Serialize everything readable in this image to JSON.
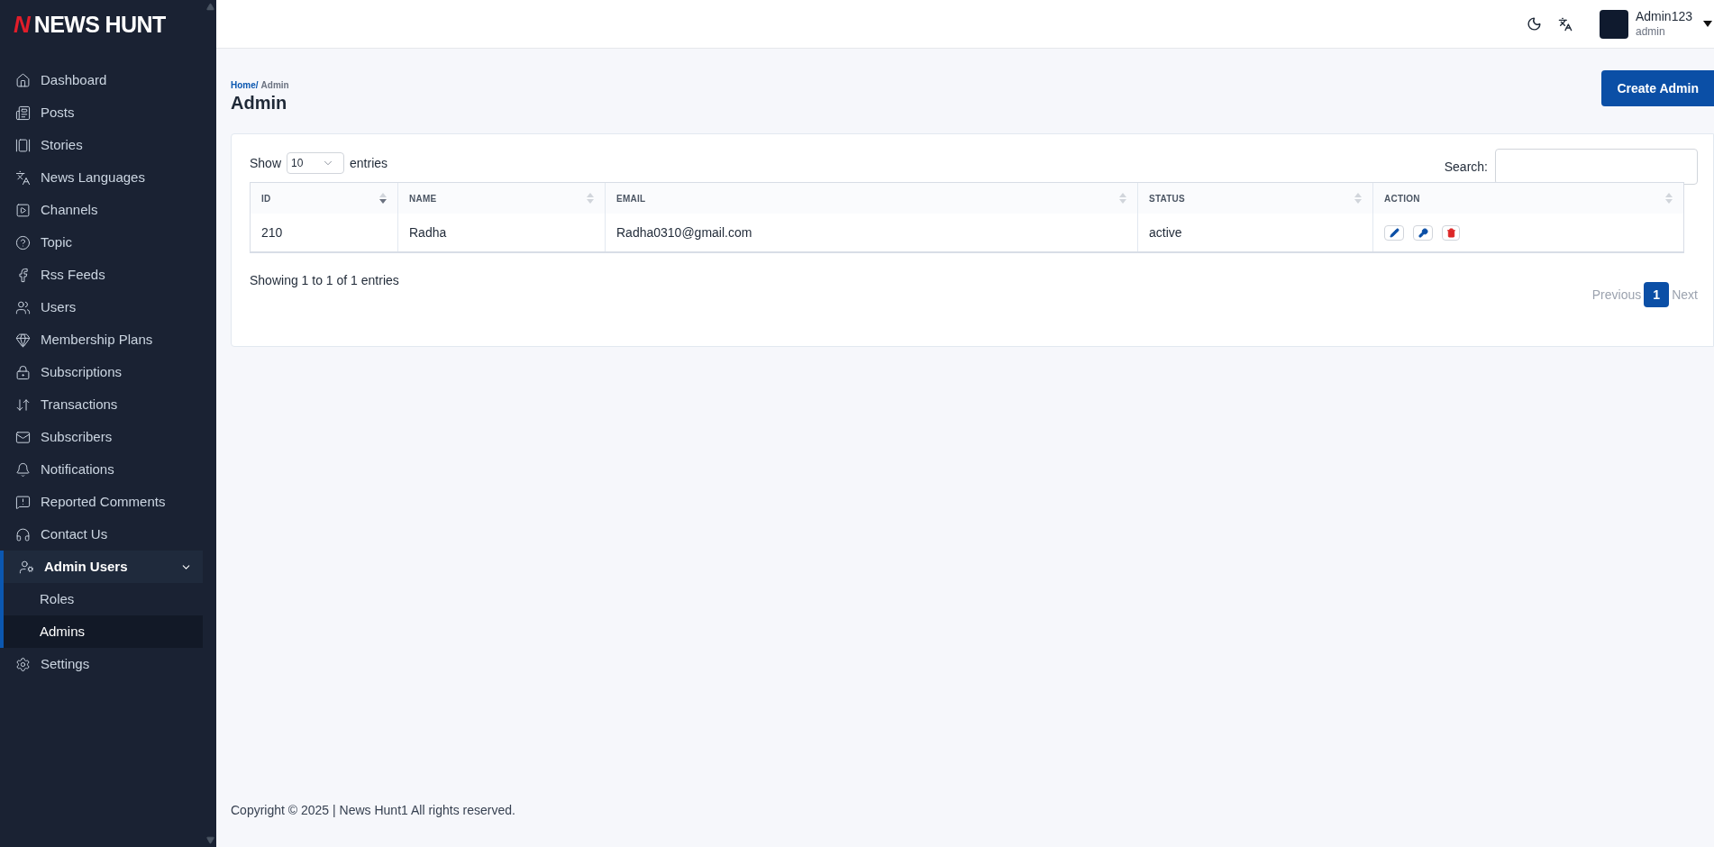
{
  "brand": {
    "mark": "N",
    "name": "NEWS HUNT"
  },
  "sidebar": {
    "items": [
      {
        "label": "Dashboard",
        "selected": false
      },
      {
        "label": "Posts",
        "selected": false
      },
      {
        "label": "Stories",
        "selected": false
      },
      {
        "label": "News Languages",
        "selected": false
      },
      {
        "label": "Channels",
        "selected": false
      },
      {
        "label": "Topic",
        "selected": false
      },
      {
        "label": "Rss Feeds",
        "selected": false
      },
      {
        "label": "Users",
        "selected": false
      },
      {
        "label": "Membership Plans",
        "selected": false
      },
      {
        "label": "Subscriptions",
        "selected": false
      },
      {
        "label": "Transactions",
        "selected": false
      },
      {
        "label": "Subscribers",
        "selected": false
      },
      {
        "label": "Notifications",
        "selected": false
      },
      {
        "label": "Reported Comments",
        "selected": false
      },
      {
        "label": "Contact Us",
        "selected": false
      },
      {
        "label": "Admin Users",
        "selected": true,
        "expanded": true,
        "children": [
          {
            "label": "Roles",
            "selected": false
          },
          {
            "label": "Admins",
            "selected": true
          }
        ]
      },
      {
        "label": "Settings",
        "selected": false
      }
    ]
  },
  "header": {
    "user_name": "Admin123",
    "user_role": "admin"
  },
  "breadcrumb": [
    {
      "label": "Home/",
      "link": true
    },
    {
      "label": "Admin",
      "link": false
    }
  ],
  "page_title": "Admin",
  "create_button": "Create Admin",
  "table_controls": {
    "show_label": "Show",
    "page_size": "10",
    "entries_label": "entries",
    "search_label": "Search:"
  },
  "table": {
    "columns": [
      {
        "label": "ID",
        "sorted": true
      },
      {
        "label": "NAME",
        "sorted": false
      },
      {
        "label": "EMAIL",
        "sorted": false
      },
      {
        "label": "STATUS",
        "sorted": false
      },
      {
        "label": "ACTION",
        "sorted": false
      }
    ],
    "rows": [
      {
        "id": "210",
        "name": "Radha",
        "email": "Radha0310@gmail.com",
        "status": "active"
      }
    ]
  },
  "info": "Showing 1 to 1 of 1 entries",
  "pagination": {
    "previous": {
      "label": "Previous",
      "disabled": true
    },
    "pages": [
      {
        "label": "1",
        "selected": true
      }
    ],
    "next": {
      "label": "Next",
      "disabled": true
    }
  },
  "footer": "Copyright © 2025 | News Hunt1 All rights reserved."
}
